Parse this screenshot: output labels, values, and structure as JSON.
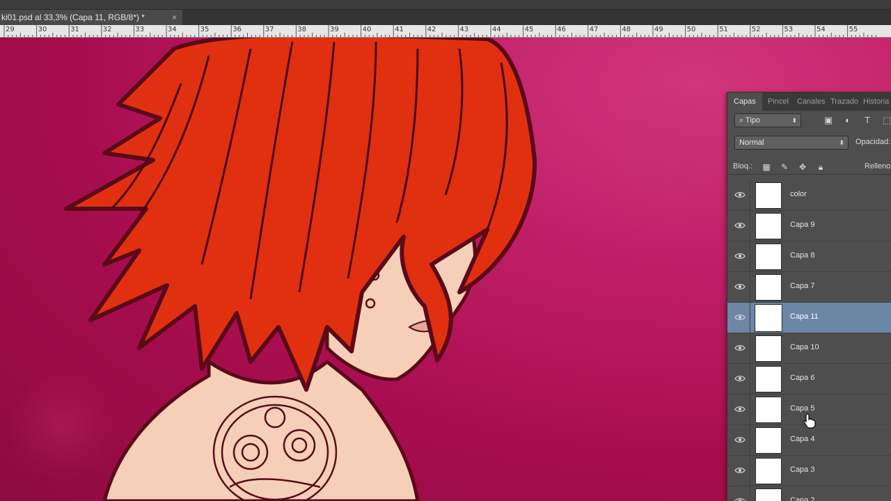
{
  "document": {
    "tab_title": "ki01.psd al 33,3% (Capa 11, RGB/8*) *",
    "close_glyph": "×"
  },
  "ruler": {
    "labels": [
      "29",
      "30",
      "31",
      "32",
      "33",
      "34",
      "35",
      "36",
      "37",
      "38",
      "39",
      "40",
      "41",
      "42",
      "43",
      "44",
      "45",
      "46",
      "47",
      "48",
      "49",
      "50",
      "51",
      "52",
      "53",
      "54",
      "55"
    ]
  },
  "panel": {
    "tabs": [
      "Capas",
      "Pincel",
      "Canales",
      "Trazado",
      "Historia"
    ],
    "active_tab": "Capas",
    "kind_filter": "Tipo",
    "blend_mode": "Normal",
    "opacity_label": "Opacidad:",
    "lock_label": "Bloq.:",
    "fill_label": "Relleno:",
    "layers": [
      {
        "name": "color",
        "visible": true,
        "selected": false
      },
      {
        "name": "Capa 9",
        "visible": true,
        "selected": false
      },
      {
        "name": "Capa 8",
        "visible": true,
        "selected": false
      },
      {
        "name": "Capa 7",
        "visible": true,
        "selected": false
      },
      {
        "name": "Capa 11",
        "visible": true,
        "selected": true
      },
      {
        "name": "Capa 10",
        "visible": true,
        "selected": false
      },
      {
        "name": "Capa 6",
        "visible": true,
        "selected": false
      },
      {
        "name": "Capa 5",
        "visible": true,
        "selected": false
      },
      {
        "name": "Capa 4",
        "visible": true,
        "selected": false
      },
      {
        "name": "Capa 3",
        "visible": true,
        "selected": false
      },
      {
        "name": "Capa 2",
        "visible": true,
        "selected": false
      }
    ]
  },
  "colors": {
    "canvas_bg": "#b8145a",
    "hair": "#e0300f",
    "skin": "#f6cfb8",
    "outline": "#5a0a18",
    "selected_layer": "#6c86a6"
  }
}
